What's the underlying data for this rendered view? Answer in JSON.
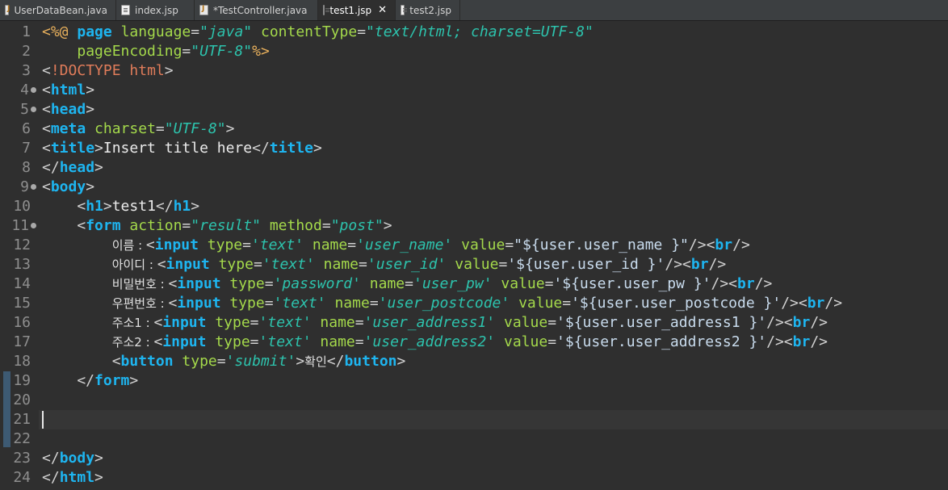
{
  "tabs": [
    {
      "label": "UserDataBean.java",
      "icon": "java-file-icon",
      "active": false
    },
    {
      "label": "index.jsp",
      "icon": "jsp-file-icon",
      "active": false
    },
    {
      "label": "*TestController.java",
      "icon": "java-file-icon",
      "active": false
    },
    {
      "label": "test1.jsp",
      "icon": "jsp-file-icon",
      "active": true
    },
    {
      "label": "test2.jsp",
      "icon": "jsp-file-icon",
      "active": false
    }
  ],
  "editor": {
    "line_numbers": [
      "1",
      "2",
      "3",
      "4",
      "5",
      "6",
      "7",
      "8",
      "9",
      "10",
      "11",
      "12",
      "13",
      "14",
      "15",
      "16",
      "17",
      "18",
      "19",
      "20",
      "21",
      "22",
      "23",
      "24"
    ],
    "folded_lines": [
      "4",
      "5",
      "9",
      "11"
    ],
    "lines": [
      {
        "n": 1,
        "tokens": [
          [
            "jsp",
            "<%@ "
          ],
          [
            "tg",
            "page"
          ],
          [
            "d",
            " "
          ],
          [
            "at",
            "language"
          ],
          [
            "d",
            "="
          ],
          [
            "v",
            "\"java\""
          ],
          [
            "d",
            " "
          ],
          [
            "at",
            "contentType"
          ],
          [
            "d",
            "="
          ],
          [
            "v",
            "\"text/html; charset=UTF-8\""
          ]
        ]
      },
      {
        "n": 2,
        "tokens": [
          [
            "d",
            "    "
          ],
          [
            "at",
            "pageEncoding"
          ],
          [
            "d",
            "="
          ],
          [
            "v",
            "\"UTF-8\""
          ],
          [
            "jsp",
            "%>"
          ]
        ]
      },
      {
        "n": 3,
        "tokens": [
          [
            "d",
            "<"
          ],
          [
            "dt",
            "!DOCTYPE "
          ],
          [
            "dt",
            "html"
          ],
          [
            "d",
            ">"
          ]
        ]
      },
      {
        "n": 4,
        "tokens": [
          [
            "d",
            "<"
          ],
          [
            "tg",
            "html"
          ],
          [
            "d",
            ">"
          ]
        ]
      },
      {
        "n": 5,
        "tokens": [
          [
            "d",
            "<"
          ],
          [
            "tg",
            "head"
          ],
          [
            "d",
            ">"
          ]
        ]
      },
      {
        "n": 6,
        "tokens": [
          [
            "d",
            "<"
          ],
          [
            "tg",
            "meta"
          ],
          [
            "d",
            " "
          ],
          [
            "at",
            "charset"
          ],
          [
            "d",
            "="
          ],
          [
            "v",
            "\"UTF-8\""
          ],
          [
            "d",
            ">"
          ]
        ]
      },
      {
        "n": 7,
        "tokens": [
          [
            "d",
            "<"
          ],
          [
            "tg",
            "title"
          ],
          [
            "d",
            ">"
          ],
          [
            "tx",
            "Insert title here"
          ],
          [
            "d",
            "</"
          ],
          [
            "tg",
            "title"
          ],
          [
            "d",
            ">"
          ]
        ]
      },
      {
        "n": 8,
        "tokens": [
          [
            "d",
            "</"
          ],
          [
            "tg",
            "head"
          ],
          [
            "d",
            ">"
          ]
        ]
      },
      {
        "n": 9,
        "tokens": [
          [
            "d",
            "<"
          ],
          [
            "tg",
            "body"
          ],
          [
            "d",
            ">"
          ]
        ]
      },
      {
        "n": 10,
        "tokens": [
          [
            "d",
            "    <"
          ],
          [
            "tg",
            "h1"
          ],
          [
            "d",
            ">"
          ],
          [
            "tx",
            "test1"
          ],
          [
            "d",
            "</"
          ],
          [
            "tg",
            "h1"
          ],
          [
            "d",
            ">"
          ]
        ]
      },
      {
        "n": 11,
        "tokens": [
          [
            "d",
            "    <"
          ],
          [
            "tg",
            "form"
          ],
          [
            "d",
            " "
          ],
          [
            "at",
            "action"
          ],
          [
            "d",
            "="
          ],
          [
            "v",
            "\"result\""
          ],
          [
            "d",
            " "
          ],
          [
            "at",
            "method"
          ],
          [
            "d",
            "="
          ],
          [
            "v",
            "\"post\""
          ],
          [
            "d",
            ">"
          ]
        ]
      },
      {
        "n": 12,
        "tokens": [
          [
            "d",
            "        "
          ],
          [
            "kr",
            "이름 : "
          ],
          [
            "d",
            "<"
          ],
          [
            "tg",
            "input"
          ],
          [
            "d",
            " "
          ],
          [
            "at",
            "type"
          ],
          [
            "d",
            "="
          ],
          [
            "v",
            "'text'"
          ],
          [
            "d",
            " "
          ],
          [
            "at",
            "name"
          ],
          [
            "d",
            "="
          ],
          [
            "v",
            "'user_name'"
          ],
          [
            "d",
            " "
          ],
          [
            "at",
            "value"
          ],
          [
            "d",
            "="
          ],
          [
            "el",
            "\"${user.user_name }\""
          ],
          [
            "d",
            "/><"
          ],
          [
            "tg",
            "br"
          ],
          [
            "d",
            "/>"
          ]
        ]
      },
      {
        "n": 13,
        "tokens": [
          [
            "d",
            "        "
          ],
          [
            "kr",
            "아이디 : "
          ],
          [
            "d",
            "<"
          ],
          [
            "tg",
            "input"
          ],
          [
            "d",
            " "
          ],
          [
            "at",
            "type"
          ],
          [
            "d",
            "="
          ],
          [
            "v",
            "'text'"
          ],
          [
            "d",
            " "
          ],
          [
            "at",
            "name"
          ],
          [
            "d",
            "="
          ],
          [
            "v",
            "'user_id'"
          ],
          [
            "d",
            " "
          ],
          [
            "at",
            "value"
          ],
          [
            "d",
            "="
          ],
          [
            "el",
            "'${user.user_id }'"
          ],
          [
            "d",
            "/><"
          ],
          [
            "tg",
            "br"
          ],
          [
            "d",
            "/>"
          ]
        ]
      },
      {
        "n": 14,
        "tokens": [
          [
            "d",
            "        "
          ],
          [
            "kr",
            "비밀번호 : "
          ],
          [
            "d",
            "<"
          ],
          [
            "tg",
            "input"
          ],
          [
            "d",
            " "
          ],
          [
            "at",
            "type"
          ],
          [
            "d",
            "="
          ],
          [
            "v",
            "'password'"
          ],
          [
            "d",
            " "
          ],
          [
            "at",
            "name"
          ],
          [
            "d",
            "="
          ],
          [
            "v",
            "'user_pw'"
          ],
          [
            "d",
            " "
          ],
          [
            "at",
            "value"
          ],
          [
            "d",
            "="
          ],
          [
            "el",
            "'${user.user_pw }'"
          ],
          [
            "d",
            "/><"
          ],
          [
            "tg",
            "br"
          ],
          [
            "d",
            "/>"
          ]
        ]
      },
      {
        "n": 15,
        "tokens": [
          [
            "d",
            "        "
          ],
          [
            "kr",
            "우편번호 : "
          ],
          [
            "d",
            "<"
          ],
          [
            "tg",
            "input"
          ],
          [
            "d",
            " "
          ],
          [
            "at",
            "type"
          ],
          [
            "d",
            "="
          ],
          [
            "v",
            "'text'"
          ],
          [
            "d",
            " "
          ],
          [
            "at",
            "name"
          ],
          [
            "d",
            "="
          ],
          [
            "v",
            "'user_postcode'"
          ],
          [
            "d",
            " "
          ],
          [
            "at",
            "value"
          ],
          [
            "d",
            "="
          ],
          [
            "el",
            "'${user.user_postcode }'"
          ],
          [
            "d",
            "/><"
          ],
          [
            "tg",
            "br"
          ],
          [
            "d",
            "/>"
          ]
        ]
      },
      {
        "n": 16,
        "tokens": [
          [
            "d",
            "        "
          ],
          [
            "kr",
            "주소1 : "
          ],
          [
            "d",
            "<"
          ],
          [
            "tg",
            "input"
          ],
          [
            "d",
            " "
          ],
          [
            "at",
            "type"
          ],
          [
            "d",
            "="
          ],
          [
            "v",
            "'text'"
          ],
          [
            "d",
            " "
          ],
          [
            "at",
            "name"
          ],
          [
            "d",
            "="
          ],
          [
            "v",
            "'user_address1'"
          ],
          [
            "d",
            " "
          ],
          [
            "at",
            "value"
          ],
          [
            "d",
            "="
          ],
          [
            "el",
            "'${user.user_address1 }'"
          ],
          [
            "d",
            "/><"
          ],
          [
            "tg",
            "br"
          ],
          [
            "d",
            "/>"
          ]
        ]
      },
      {
        "n": 17,
        "tokens": [
          [
            "d",
            "        "
          ],
          [
            "kr",
            "주소2 : "
          ],
          [
            "d",
            "<"
          ],
          [
            "tg",
            "input"
          ],
          [
            "d",
            " "
          ],
          [
            "at",
            "type"
          ],
          [
            "d",
            "="
          ],
          [
            "v",
            "'text'"
          ],
          [
            "d",
            " "
          ],
          [
            "at",
            "name"
          ],
          [
            "d",
            "="
          ],
          [
            "v",
            "'user_address2'"
          ],
          [
            "d",
            " "
          ],
          [
            "at",
            "value"
          ],
          [
            "d",
            "="
          ],
          [
            "el",
            "'${user.user_address2 }'"
          ],
          [
            "d",
            "/><"
          ],
          [
            "tg",
            "br"
          ],
          [
            "d",
            "/>"
          ]
        ]
      },
      {
        "n": 18,
        "tokens": [
          [
            "d",
            "        <"
          ],
          [
            "tg",
            "button"
          ],
          [
            "d",
            " "
          ],
          [
            "at",
            "type"
          ],
          [
            "d",
            "="
          ],
          [
            "v",
            "'submit'"
          ],
          [
            "d",
            ">"
          ],
          [
            "kr",
            "확인"
          ],
          [
            "d",
            "</"
          ],
          [
            "tg",
            "button"
          ],
          [
            "d",
            ">"
          ]
        ]
      },
      {
        "n": 19,
        "tokens": [
          [
            "d",
            "    </"
          ],
          [
            "tg",
            "form"
          ],
          [
            "d",
            ">"
          ]
        ]
      },
      {
        "n": 20,
        "tokens": []
      },
      {
        "n": 21,
        "tokens": []
      },
      {
        "n": 22,
        "tokens": []
      },
      {
        "n": 23,
        "tokens": [
          [
            "d",
            "</"
          ],
          [
            "tg",
            "body"
          ],
          [
            "d",
            ">"
          ]
        ]
      },
      {
        "n": 24,
        "tokens": [
          [
            "d",
            "</"
          ],
          [
            "tg",
            "html"
          ],
          [
            "d",
            ">"
          ]
        ]
      }
    ]
  }
}
